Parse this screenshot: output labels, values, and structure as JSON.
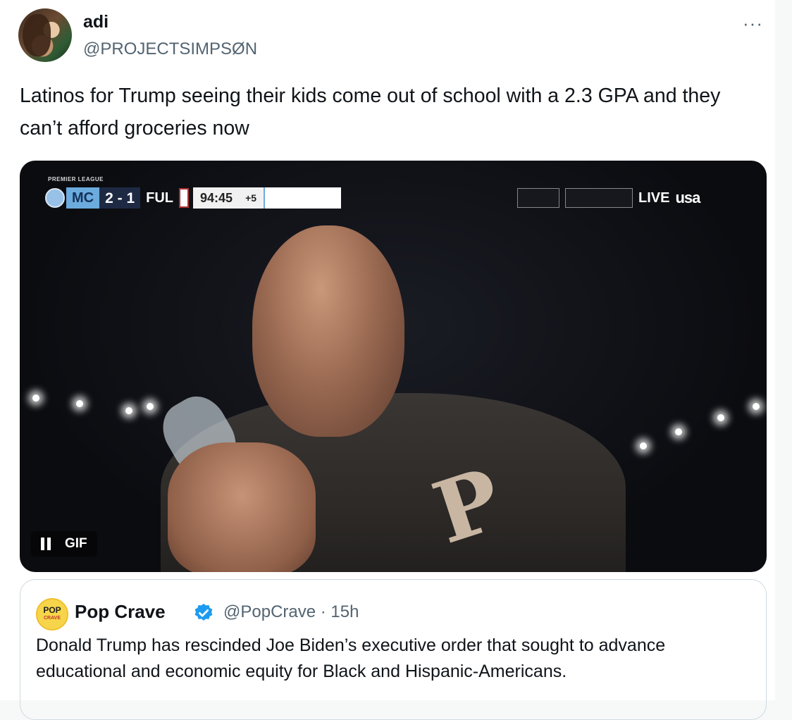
{
  "tweet": {
    "display_name": "adi",
    "handle": "@PROJECTSIMPSØN",
    "more_label": "···",
    "text": "Latinos for Trump seeing their kids come out of school with a 2.3 GPA and they can’t afford groceries now"
  },
  "media": {
    "scorebug": {
      "league": "PREMIER LEAGUE",
      "home_team": "MC",
      "score": "2 - 1",
      "away_team": "FUL",
      "clock": "94:45",
      "added_time": "+5"
    },
    "broadcast": {
      "live_label": "LIVE",
      "network": "usa"
    },
    "gif_label": "GIF"
  },
  "quote": {
    "avatar_text_top": "POP",
    "avatar_text_bottom": "CRAVE",
    "name": "Pop Crave",
    "handle_time": "@PopCrave · 15h",
    "text": "Donald Trump has rescinded Joe Biden’s executive order that sought to advance educational and economic equity for Black and Hispanic-Americans."
  },
  "colors": {
    "verified": "#1d9bf0",
    "secondary_text": "#536471",
    "border": "#cfd9de"
  }
}
